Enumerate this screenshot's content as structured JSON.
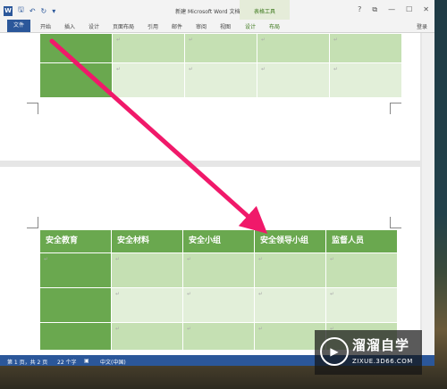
{
  "window": {
    "title": "新建 Microsoft Word 文档 - Word",
    "app_icon": "W",
    "contextual_group": "表格工具",
    "controls": {
      "help": "?",
      "restore": "⧉",
      "minimize": "—",
      "maximize": "☐",
      "close": "✕"
    }
  },
  "ribbon": {
    "file_tab": "文件",
    "tabs": [
      "开始",
      "插入",
      "设计",
      "页面布局",
      "引用",
      "邮件",
      "审阅",
      "视图"
    ],
    "contextual_tabs": [
      "设计",
      "布局"
    ],
    "signin": "登录"
  },
  "table": {
    "headers": [
      "安全教育",
      "安全材料",
      "安全小组",
      "安全领导小组",
      "监督人员"
    ],
    "cell_mark": "↵"
  },
  "status": {
    "page": "第 1 页，共 2 页",
    "words": "22 个字",
    "language": "中文(中国)"
  },
  "watermark": {
    "name": "溜溜自学",
    "url": "ZIXUE.3D66.COM"
  },
  "colors": {
    "accent_green": "#6aa84f",
    "light_green": "#c5e0b3",
    "word_blue": "#2b579a",
    "arrow": "#f0196a"
  }
}
